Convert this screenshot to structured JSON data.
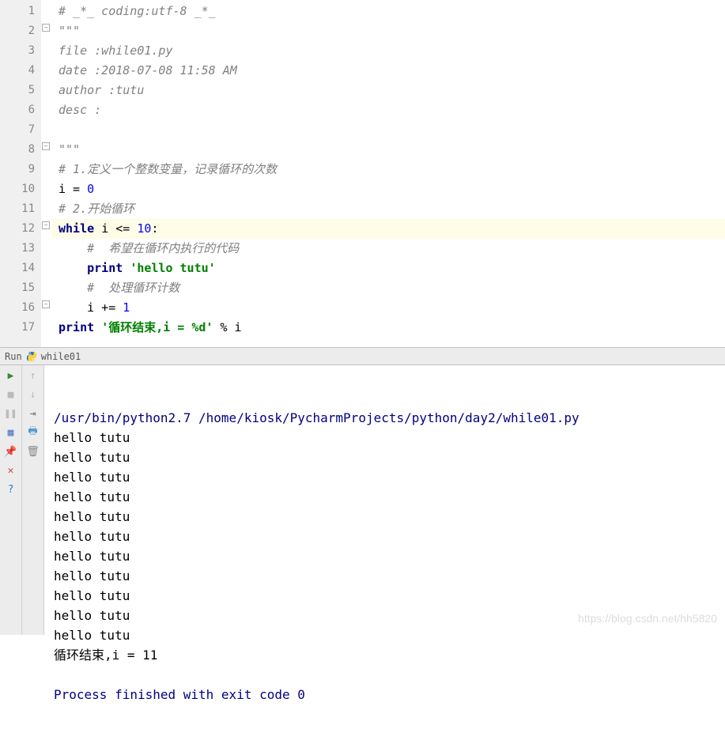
{
  "editor": {
    "lines": [
      {
        "n": 1,
        "type": "cm",
        "t": "# _*_ coding:utf-8 _*_"
      },
      {
        "n": 2,
        "type": "cm",
        "t": "\"\"\""
      },
      {
        "n": 3,
        "type": "cm",
        "t": "file :while01.py"
      },
      {
        "n": 4,
        "type": "cm",
        "t": "date :2018-07-08 11:58 AM"
      },
      {
        "n": 5,
        "type": "cm",
        "t": "author :tutu"
      },
      {
        "n": 6,
        "type": "cm",
        "t": "desc :"
      },
      {
        "n": 7,
        "type": "cm",
        "t": ""
      },
      {
        "n": 8,
        "type": "cm",
        "t": "\"\"\""
      },
      {
        "n": 9,
        "type": "cm",
        "t": "# 1.定义一个整数变量，记录循环的次数"
      },
      {
        "n": 10,
        "type": "mix",
        "parts": [
          {
            "c": "op",
            "t": "i = "
          },
          {
            "c": "nm",
            "t": "0"
          }
        ]
      },
      {
        "n": 11,
        "type": "cm",
        "t": "# 2.开始循环"
      },
      {
        "n": 12,
        "hl": true,
        "type": "mix",
        "parts": [
          {
            "c": "kw",
            "t": "while "
          },
          {
            "c": "op",
            "t": "i <= "
          },
          {
            "c": "nm",
            "t": "10"
          },
          {
            "c": "op",
            "t": ":"
          }
        ]
      },
      {
        "n": 13,
        "type": "mix",
        "indent": "    ",
        "parts": [
          {
            "c": "cm",
            "t": "#  希望在循环内执行的代码"
          }
        ]
      },
      {
        "n": 14,
        "type": "mix",
        "indent": "    ",
        "parts": [
          {
            "c": "kw",
            "t": "print "
          },
          {
            "c": "st",
            "t": "'hello tutu'"
          }
        ]
      },
      {
        "n": 15,
        "type": "mix",
        "indent": "    ",
        "parts": [
          {
            "c": "cm",
            "t": "#  处理循环计数"
          }
        ]
      },
      {
        "n": 16,
        "type": "mix",
        "indent": "    ",
        "parts": [
          {
            "c": "op",
            "t": "i += "
          },
          {
            "c": "nm",
            "t": "1"
          }
        ]
      },
      {
        "n": 17,
        "type": "mix",
        "parts": [
          {
            "c": "kw",
            "t": "print "
          },
          {
            "c": "st",
            "t": "'循环结束,i = %d'"
          },
          {
            "c": "op",
            "t": " % i"
          }
        ]
      }
    ]
  },
  "runbar": {
    "label": "Run",
    "config": "while01"
  },
  "console": {
    "cmd": "/usr/bin/python2.7 /home/kiosk/PycharmProjects/python/day2/while01.py",
    "lines": [
      "hello tutu",
      "hello tutu",
      "hello tutu",
      "hello tutu",
      "hello tutu",
      "hello tutu",
      "hello tutu",
      "hello tutu",
      "hello tutu",
      "hello tutu",
      "hello tutu",
      "循环结束,i = 11"
    ],
    "exit": "Process finished with exit code 0"
  },
  "watermark": "https://blog.csdn.net/hh5820"
}
